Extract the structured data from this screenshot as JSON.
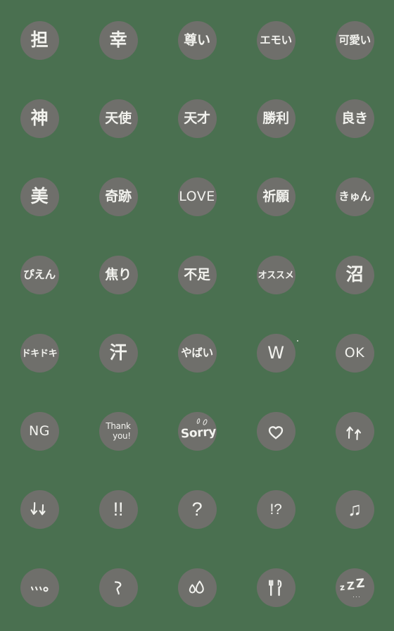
{
  "sheet": {
    "title": "Handwritten Japanese Reaction Emoji Set",
    "background_color": "#4a7050",
    "bubble_color": "#6f6f6b",
    "ink_color": "#f2f2ee",
    "columns": 5,
    "rows": 8,
    "total": 40
  },
  "emoji": [
    {
      "id": "tan",
      "label": "担",
      "kind": "text",
      "size": "t-1"
    },
    {
      "id": "kou",
      "label": "幸",
      "kind": "text",
      "size": "t-1"
    },
    {
      "id": "toutoi",
      "label": "尊い",
      "kind": "text",
      "size": "t-2"
    },
    {
      "id": "emoi",
      "label": "エモい",
      "kind": "text",
      "size": "t-3"
    },
    {
      "id": "kawaii",
      "label": "可愛い",
      "kind": "text",
      "size": "t-3"
    },
    {
      "id": "kami",
      "label": "神",
      "kind": "text",
      "size": "t-1"
    },
    {
      "id": "tenshi",
      "label": "天使",
      "kind": "text",
      "size": "t-2"
    },
    {
      "id": "tensai",
      "label": "天才",
      "kind": "text",
      "size": "t-2"
    },
    {
      "id": "shouri",
      "label": "勝利",
      "kind": "text",
      "size": "t-2"
    },
    {
      "id": "yoki",
      "label": "良き",
      "kind": "text",
      "size": "t-2"
    },
    {
      "id": "bi",
      "label": "美",
      "kind": "text",
      "size": "t-1"
    },
    {
      "id": "kiseki",
      "label": "奇跡",
      "kind": "text",
      "size": "t-2"
    },
    {
      "id": "love",
      "label": "LOVE",
      "kind": "text",
      "size": "t-lat"
    },
    {
      "id": "kigan",
      "label": "祈願",
      "kind": "text",
      "size": "t-2"
    },
    {
      "id": "kyun",
      "label": "きゅん",
      "kind": "text",
      "size": "t-3"
    },
    {
      "id": "pien",
      "label": "ぴえん",
      "kind": "text",
      "size": "t-3"
    },
    {
      "id": "aseri",
      "label": "焦り",
      "kind": "text",
      "size": "t-2"
    },
    {
      "id": "fusoku",
      "label": "不足",
      "kind": "text",
      "size": "t-2"
    },
    {
      "id": "osusume",
      "label": "オススメ",
      "kind": "text",
      "size": "t-4"
    },
    {
      "id": "numa",
      "label": "沼",
      "kind": "text",
      "size": "t-1"
    },
    {
      "id": "dokidoki",
      "label": "ドキドキ",
      "kind": "text",
      "size": "t-4"
    },
    {
      "id": "ase",
      "label": "汗",
      "kind": "text",
      "size": "t-1"
    },
    {
      "id": "yabai",
      "label": "やばい",
      "kind": "text",
      "size": "t-3"
    },
    {
      "id": "warai-w",
      "label": "W",
      "kind": "w",
      "size": "t-lat"
    },
    {
      "id": "ok",
      "label": "OK",
      "kind": "text",
      "size": "t-lat"
    },
    {
      "id": "ng",
      "label": "NG",
      "kind": "text",
      "size": "t-lat"
    },
    {
      "id": "thank-you",
      "label": "Thank\nyou!",
      "line1": "Thank",
      "line2": "you!",
      "kind": "two-line",
      "size": "t-lat-sm"
    },
    {
      "id": "sorry",
      "label": "Sorry",
      "kind": "sorry",
      "size": "t-lat-sm"
    },
    {
      "id": "heart",
      "label": "heart",
      "kind": "heart"
    },
    {
      "id": "arrows-up",
      "label": "↑↑",
      "kind": "arrows-up"
    },
    {
      "id": "arrows-down",
      "label": "↓↓",
      "kind": "arrows-down"
    },
    {
      "id": "exclaim-2",
      "label": "!!",
      "kind": "text",
      "size": "t-sym"
    },
    {
      "id": "question",
      "label": "?",
      "kind": "text",
      "size": "t-sym"
    },
    {
      "id": "interrobang",
      "label": "!?",
      "kind": "text",
      "size": "t-sym-sm"
    },
    {
      "id": "music-note",
      "label": "♫",
      "kind": "text",
      "size": "t-sym"
    },
    {
      "id": "ellipsis",
      "label": "、、、。",
      "kind": "ellipsis"
    },
    {
      "id": "wave-dash",
      "label": "〜",
      "kind": "wave"
    },
    {
      "id": "sweat-drops",
      "label": "sweat drops",
      "kind": "sweat"
    },
    {
      "id": "fork-knife",
      "label": "fork and knife",
      "kind": "cutlery"
    },
    {
      "id": "zzz",
      "label": "zZZ",
      "kind": "zzz"
    }
  ]
}
